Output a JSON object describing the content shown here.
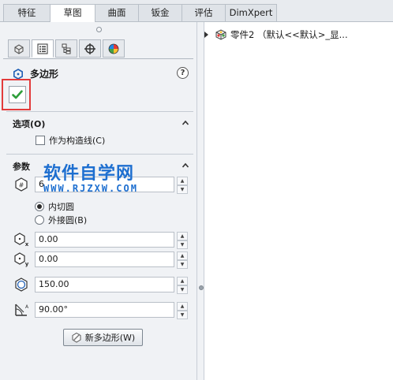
{
  "tabs": [
    {
      "label": "特征",
      "active": false
    },
    {
      "label": "草图",
      "active": true
    },
    {
      "label": "曲面",
      "active": false
    },
    {
      "label": "钣金",
      "active": false
    },
    {
      "label": "评估",
      "active": false
    },
    {
      "label": "DimXpert",
      "active": false
    }
  ],
  "panel": {
    "title": "多边形",
    "help_symbol": "?",
    "options": {
      "heading": "选项(O)",
      "construction_label": "作为构造线(C)",
      "construction_checked": false
    },
    "params": {
      "heading": "参数",
      "sides": "6",
      "inscribed_label": "内切圆",
      "circumscribed_label": "外接圆(B)",
      "selected": "inscribed",
      "center_x": "0.00",
      "center_y": "0.00",
      "diameter": "150.00",
      "angle": "90.00°"
    },
    "new_polygon_button": "新多边形(W)"
  },
  "watermark": {
    "line1": "软件自学网",
    "line2": "WWW.RJZXW.COM"
  },
  "tree": {
    "root_label": "零件2 （默认<<默认>_显..."
  },
  "colors": {
    "accent_green": "#2e9e3a",
    "highlight_red": "#e23b3b",
    "watermark_blue": "#1e6fd0"
  }
}
